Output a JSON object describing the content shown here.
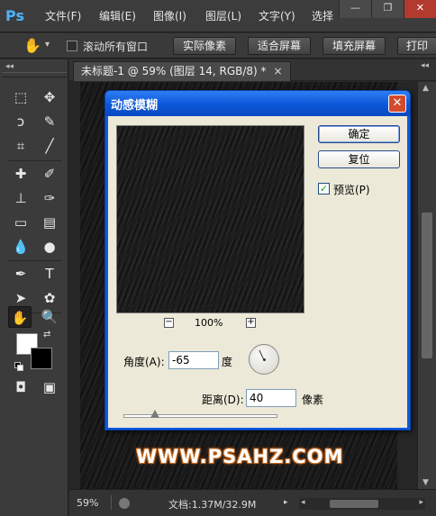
{
  "app": {
    "logo": "Ps"
  },
  "menu": [
    "文件(F)",
    "编辑(E)",
    "图像(I)",
    "图层(L)",
    "文字(Y)",
    "选择"
  ],
  "window_controls": {
    "minimize": "—",
    "restore": "❐",
    "close": "✕"
  },
  "options_bar": {
    "scroll_all_label": "滚动所有窗口",
    "scroll_all_checked": false,
    "buttons": [
      "实际像素",
      "适合屏幕",
      "填充屏幕",
      "打印"
    ]
  },
  "document": {
    "tab_title": "未标题-1 @ 59% (图层 14, RGB/8) *",
    "tab_close": "×",
    "zoom": "59%",
    "doc_info": "文档:1.37M/32.9M",
    "watermark": "WWW.PSAHZ.COM"
  },
  "dialog": {
    "title": "动感模糊",
    "close": "✕",
    "ok_label": "确定",
    "reset_label": "复位",
    "preview_label": "预览(P)",
    "preview_checked": true,
    "preview_zoom": "100%",
    "zoom_out": "−",
    "zoom_in": "+",
    "angle_label": "角度(A):",
    "angle_value": "-65",
    "angle_unit": "度",
    "distance_label": "距离(D):",
    "distance_value": "40",
    "distance_unit": "像素"
  }
}
